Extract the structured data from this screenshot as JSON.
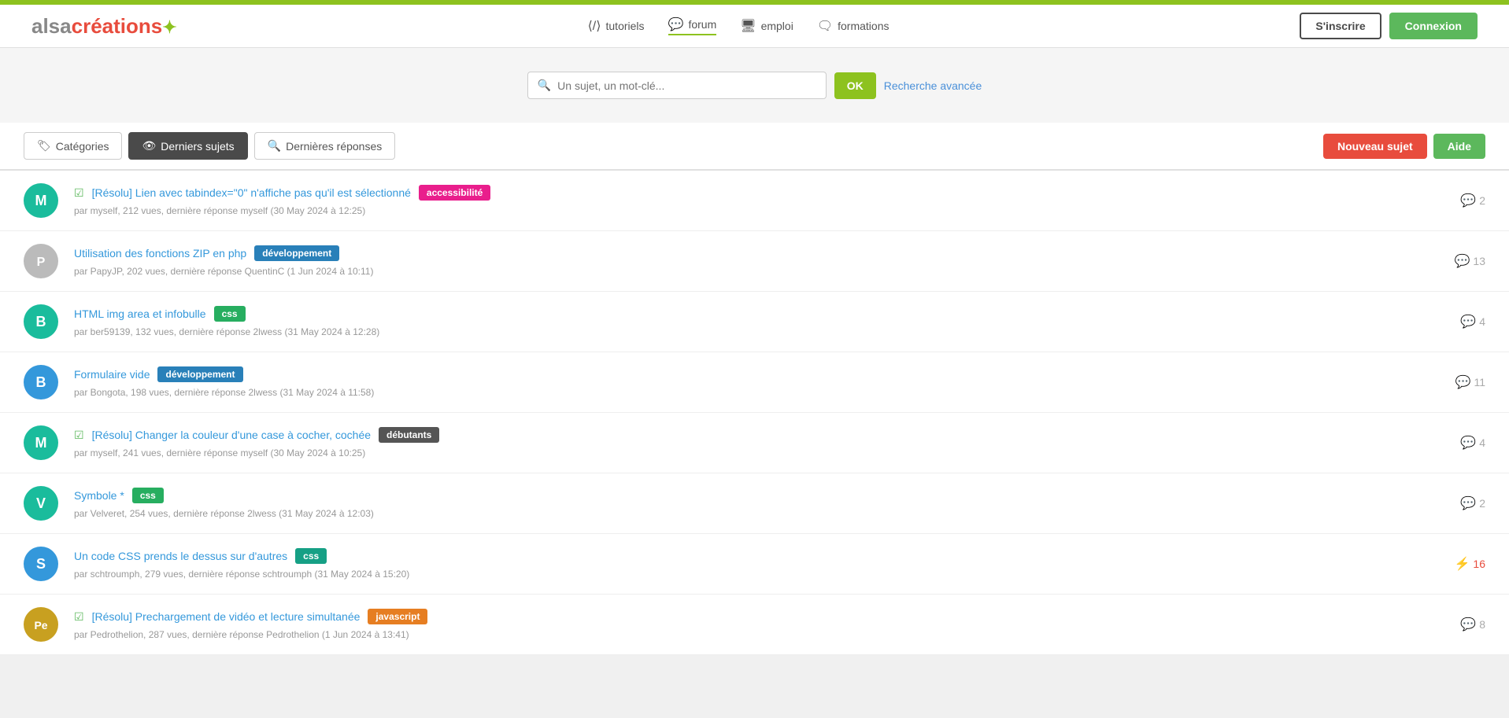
{
  "topbar": {
    "accent_color": "#8dc21f"
  },
  "header": {
    "logo_alsa": "alsa",
    "logo_creations": "créations",
    "logo_accent": "✦",
    "nav_items": [
      {
        "id": "tutoriels",
        "icon": "⟨⟩",
        "label": "tutoriels",
        "active": false
      },
      {
        "id": "forum",
        "icon": "💬",
        "label": "forum",
        "active": true
      },
      {
        "id": "emploi",
        "icon": "🖥",
        "label": "emploi",
        "active": false
      },
      {
        "id": "formations",
        "icon": "🗨",
        "label": "formations",
        "active": false
      }
    ],
    "btn_register": "S'inscrire",
    "btn_login": "Connexion"
  },
  "search": {
    "placeholder": "Un sujet, un mot-clé...",
    "btn_ok": "OK",
    "advanced": "Recherche avancée"
  },
  "tabs": [
    {
      "id": "categories",
      "icon": "🏷",
      "label": "Catégories",
      "active": false
    },
    {
      "id": "derniers-sujets",
      "icon": "👁",
      "label": "Derniers sujets",
      "active": true
    },
    {
      "id": "dernieres-reponses",
      "icon": "🔍",
      "label": "Dernières réponses",
      "active": false
    }
  ],
  "btn_new_topic": "Nouveau sujet",
  "btn_help": "Aide",
  "topics": [
    {
      "id": 1,
      "avatar_letter": "M",
      "avatar_color": "teal",
      "resolved": true,
      "title": "[Résolu] Lien avec tabindex=\"0\" n'affiche pas qu'il est sélectionné",
      "tag": "accessibilité",
      "tag_color": "pink",
      "meta": "par myself, 212 vues, dernière réponse myself (30 May 2024 à 12:25)",
      "replies": 2,
      "hot": false
    },
    {
      "id": 2,
      "avatar_letter": "P",
      "avatar_color": "img",
      "avatar_src": "",
      "resolved": false,
      "title": "Utilisation des fonctions ZIP en php",
      "tag": "développement",
      "tag_color": "blue-dark",
      "meta": "par PapyJP, 202 vues, dernière réponse QuentinC (1 Jun 2024 à 10:11)",
      "replies": 13,
      "hot": false
    },
    {
      "id": 3,
      "avatar_letter": "B",
      "avatar_color": "teal",
      "resolved": false,
      "title": "HTML img area et infobulle",
      "tag": "css",
      "tag_color": "green",
      "meta": "par ber59139, 132 vues, dernière réponse 2lwess (31 May 2024 à 12:28)",
      "replies": 4,
      "hot": false
    },
    {
      "id": 4,
      "avatar_letter": "B",
      "avatar_color": "blue",
      "resolved": false,
      "title": "Formulaire vide",
      "tag": "développement",
      "tag_color": "blue-dark",
      "meta": "par Bongota, 198 vues, dernière réponse 2lwess (31 May 2024 à 11:58)",
      "replies": 11,
      "hot": false
    },
    {
      "id": 5,
      "avatar_letter": "M",
      "avatar_color": "teal",
      "resolved": true,
      "title": "[Résolu] Changer la couleur d'une case à cocher, cochée",
      "tag": "débutants",
      "tag_color": "gray",
      "meta": "par myself, 241 vues, dernière réponse myself (30 May 2024 à 10:25)",
      "replies": 4,
      "hot": false
    },
    {
      "id": 6,
      "avatar_letter": "V",
      "avatar_color": "teal",
      "resolved": false,
      "title": "Symbole *",
      "tag": "css",
      "tag_color": "green",
      "meta": "par Velveret, 254 vues, dernière réponse 2lwess (31 May 2024 à 12:03)",
      "replies": 2,
      "hot": false
    },
    {
      "id": 7,
      "avatar_letter": "S",
      "avatar_color": "blue",
      "resolved": false,
      "title": "Un code CSS prends le dessus sur d'autres",
      "tag": "css",
      "tag_color": "teal",
      "meta": "par schtroumph, 279 vues, dernière réponse schtroumph (31 May 2024 à 15:20)",
      "replies": 16,
      "hot": true
    },
    {
      "id": 8,
      "avatar_letter": "Pe",
      "avatar_color": "img",
      "avatar_src": "",
      "resolved": true,
      "title": "[Résolu] Prechargement de vidéo et lecture simultanée",
      "tag": "javascript",
      "tag_color": "orange",
      "meta": "par Pedrothelion, 287 vues, dernière réponse Pedrothelion (1 Jun 2024 à 13:41)",
      "replies": 8,
      "hot": false
    }
  ]
}
